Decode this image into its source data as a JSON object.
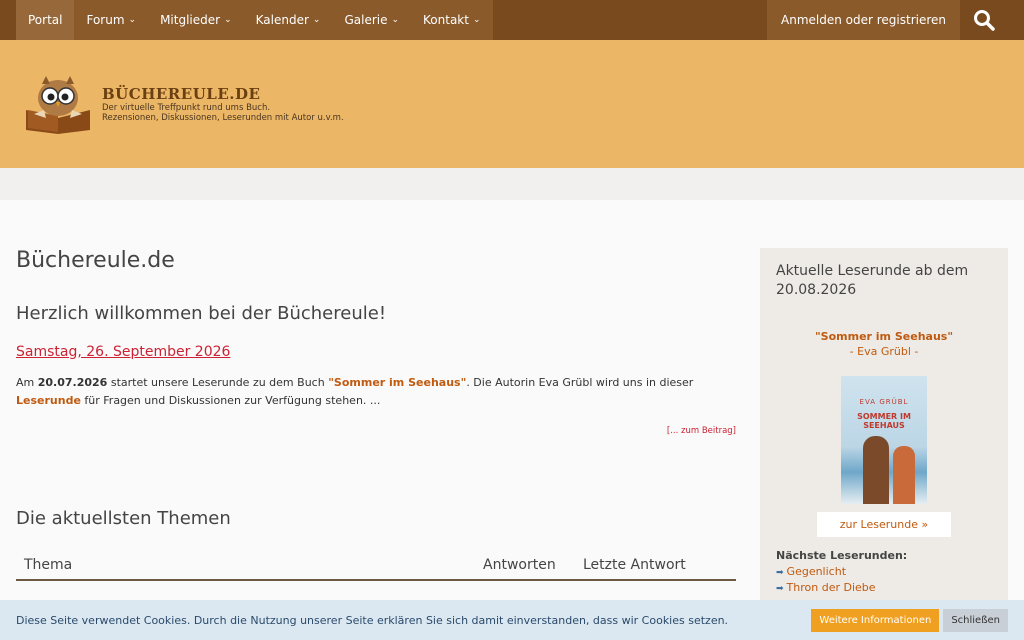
{
  "nav": {
    "items": [
      {
        "label": "Portal",
        "dropdown": false
      },
      {
        "label": "Forum",
        "dropdown": true
      },
      {
        "label": "Mitglieder",
        "dropdown": true
      },
      {
        "label": "Kalender",
        "dropdown": true
      },
      {
        "label": "Galerie",
        "dropdown": true
      },
      {
        "label": "Kontakt",
        "dropdown": true
      }
    ],
    "login": "Anmelden oder registrieren"
  },
  "header": {
    "site_name": "BÜCHEREULE.DE",
    "tagline1": "Der virtuelle Treffpunkt rund ums Buch.",
    "tagline2": "Rezensionen, Diskussionen, Leserunden mit Autor u.v.m."
  },
  "main": {
    "page_title": "Büchereule.de",
    "welcome": "Herzlich willkommen bei der Büchereule!",
    "date": "Samstag, 26. September 2026",
    "intro": {
      "p1": "Am ",
      "date": "20.07.2026",
      "p2": " startet unsere Leserunde zu dem Buch ",
      "book": "\"Sommer im Seehaus\"",
      "p3": ". Die Autorin Eva Grübl wird uns in dieser ",
      "leserunde": "Leserunde",
      "p4": " für Fragen und Diskussionen zur Verfügung stehen. ..."
    },
    "more_link": "[... zum Beitrag]",
    "themes_title": "Die aktuellsten Themen",
    "table_headers": [
      "Thema",
      "Antworten",
      "Letzte Antwort"
    ]
  },
  "sidebar": {
    "title": "Aktuelle Leserunde ab dem 20.08.2026",
    "book_title": "\"Sommer im Seehaus\"",
    "author": "- Eva Grübl -",
    "cover_author": "EVA GRÜBL",
    "cover_title": "SOMMER IM SEEHAUS",
    "button": "zur Leserunde »",
    "next_label": "Nächste Leserunden:",
    "next_items": [
      "Gegenlicht",
      "Thron der Diebe"
    ]
  },
  "cookie": {
    "text": "Diese Seite verwendet Cookies. Durch die Nutzung unserer Seite erklären Sie sich damit einverstanden, dass wir Cookies setzen.",
    "more": "Weitere Informationen",
    "close": "Schließen"
  },
  "colors": {
    "nav_bg": "#7a4a1f",
    "header_bg": "#ebb766",
    "accent": "#c05a10",
    "link_red": "#cc2233"
  }
}
